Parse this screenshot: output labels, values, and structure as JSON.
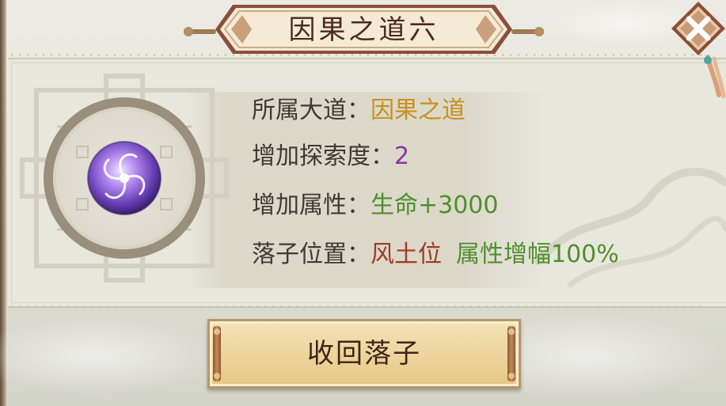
{
  "dialog": {
    "title": "因果之道六",
    "close_icon": "close-x-icon"
  },
  "info": {
    "path": {
      "label": "所属大道：",
      "value": "因果之道"
    },
    "exploration": {
      "label": "增加探索度：",
      "value": "2"
    },
    "attribute": {
      "label": "增加属性：",
      "value": "生命+3000"
    },
    "position": {
      "label": "落子位置：",
      "value": "风土位",
      "bonus": "属性增幅100%"
    }
  },
  "orb": {
    "icon": "purple-orb-icon"
  },
  "actions": {
    "recall_label": "收回落子"
  },
  "colors": {
    "gold": "#c9901e",
    "purple": "#8a36a6",
    "green": "#4f8f2c",
    "red": "#9f3b23",
    "title_text": "#4d2a1a"
  }
}
